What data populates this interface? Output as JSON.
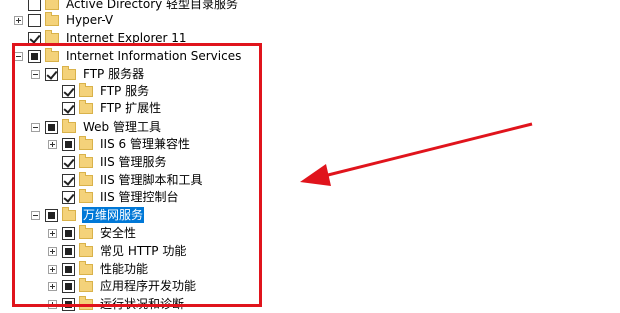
{
  "tree": {
    "items": [
      {
        "label": "Active Directory 轻型目录服务",
        "state": "unchecked",
        "expander": "none"
      },
      {
        "label": "Hyper-V",
        "state": "unchecked",
        "expander": "plus"
      },
      {
        "label": "Internet Explorer 11",
        "state": "checked",
        "expander": "none"
      },
      {
        "label": "Internet Information Services",
        "state": "partial",
        "expander": "minus"
      },
      {
        "label": "FTP 服务器",
        "state": "checked",
        "expander": "minus"
      },
      {
        "label": "FTP 服务",
        "state": "checked",
        "expander": "none"
      },
      {
        "label": "FTP 扩展性",
        "state": "checked",
        "expander": "none"
      },
      {
        "label": "Web 管理工具",
        "state": "partial",
        "expander": "minus"
      },
      {
        "label": "IIS 6 管理兼容性",
        "state": "partial",
        "expander": "plus"
      },
      {
        "label": "IIS 管理服务",
        "state": "checked",
        "expander": "none"
      },
      {
        "label": "IIS 管理脚本和工具",
        "state": "checked",
        "expander": "none"
      },
      {
        "label": "IIS 管理控制台",
        "state": "checked",
        "expander": "none"
      },
      {
        "label": "万维网服务",
        "state": "partial",
        "expander": "minus",
        "selected": true
      },
      {
        "label": "安全性",
        "state": "partial",
        "expander": "plus"
      },
      {
        "label": "常见 HTTP 功能",
        "state": "partial",
        "expander": "plus"
      },
      {
        "label": "性能功能",
        "state": "partial",
        "expander": "plus"
      },
      {
        "label": "应用程序开发功能",
        "state": "partial",
        "expander": "plus"
      },
      {
        "label": "运行状况和诊断",
        "state": "partial",
        "expander": "plus"
      }
    ]
  },
  "annotations": {
    "highlight_color": "#e0141c"
  }
}
